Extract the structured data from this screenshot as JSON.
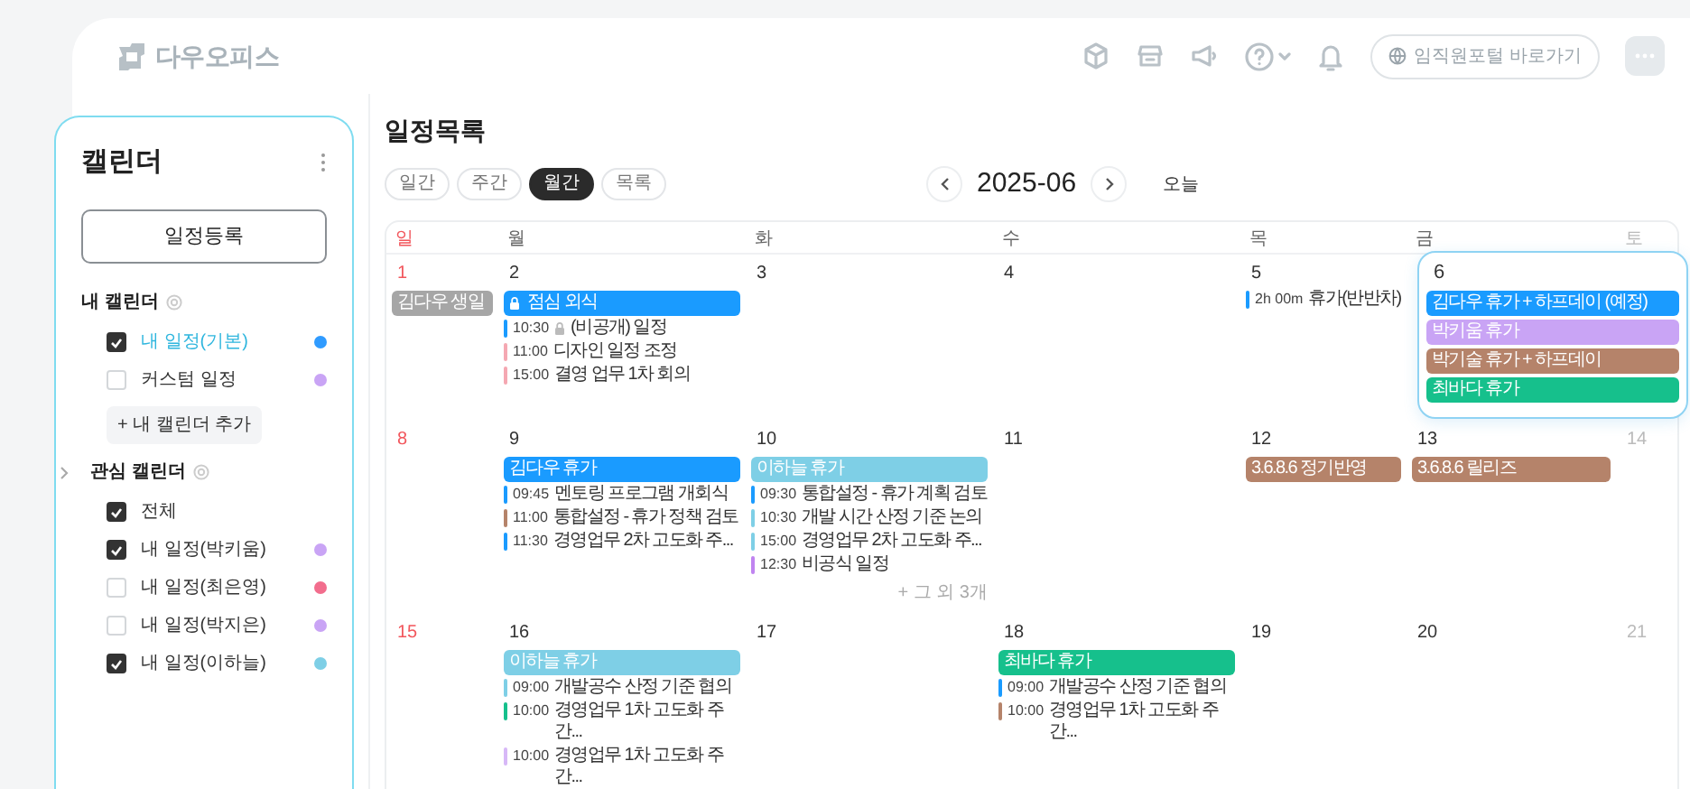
{
  "header": {
    "logo_text": "다우오피스",
    "portal_button": "임직원포털 바로가기"
  },
  "sidebar": {
    "title": "캘린더",
    "create_button": "일정등록",
    "sections": [
      {
        "title": "내 캘린더",
        "has_toggle": false,
        "add_button": "+ 내 캘린더 추가",
        "items": [
          {
            "label": "내 일정(기본)",
            "checked": true,
            "selected": true,
            "color": "#2f9bff"
          },
          {
            "label": "커스텀 일정",
            "checked": false,
            "selected": false,
            "color": "#c9a4f5"
          }
        ]
      },
      {
        "title": "관심 캘린더",
        "has_toggle": true,
        "items": [
          {
            "label": "전체",
            "checked": true,
            "selected": false
          },
          {
            "label": "내 일정(박키움)",
            "checked": true,
            "selected": false,
            "color": "#c9a4f5"
          },
          {
            "label": "내 일정(최은영)",
            "checked": false,
            "selected": false,
            "color": "#f26d8d"
          },
          {
            "label": "내 일정(박지은)",
            "checked": false,
            "selected": false,
            "color": "#c9a4f5"
          },
          {
            "label": "내 일정(이하늘)",
            "checked": true,
            "selected": false,
            "color": "#7ecfe6"
          }
        ]
      }
    ]
  },
  "main": {
    "title": "일정목록",
    "views": [
      {
        "label": "일간",
        "selected": false
      },
      {
        "label": "주간",
        "selected": false
      },
      {
        "label": "월간",
        "selected": true
      },
      {
        "label": "목록",
        "selected": false
      }
    ],
    "month": "2025-06",
    "today_button": "오늘",
    "calendar": {
      "weekdays": [
        "일",
        "월",
        "화",
        "수",
        "목",
        "금",
        "토"
      ],
      "weeks": [
        {
          "days": [
            {
              "day": "1",
              "events": [
                {
                  "kind": "bar",
                  "color": "#a6a6a6",
                  "title": "김다우 생일",
                  "locked": false
                }
              ]
            },
            {
              "day": "2",
              "events": [
                {
                  "kind": "bar",
                  "color": "#1a9bff",
                  "title": "점심 외식",
                  "locked": true
                },
                {
                  "kind": "timed",
                  "color": "#1a9bff",
                  "time": "10:30",
                  "title": "(비공개) 일정",
                  "locked": true
                },
                {
                  "kind": "timed",
                  "color": "#f5a8b2",
                  "time": "11:00",
                  "title": "디자인 일정 조정",
                  "locked": false
                },
                {
                  "kind": "timed",
                  "color": "#f5a8b2",
                  "time": "15:00",
                  "title": "결영 업무 1차 회의",
                  "locked": false
                }
              ]
            },
            {
              "day": "3"
            },
            {
              "day": "4"
            },
            {
              "day": "5",
              "events": [
                {
                  "kind": "timed",
                  "color": "#1a9bff",
                  "time": "2h 00m",
                  "title": "휴가(반반차)",
                  "locked": false
                }
              ]
            },
            {
              "day": "6",
              "expanded": true,
              "events": [
                {
                  "kind": "bar",
                  "color": "#1a9bff",
                  "title": "김다우 휴가 + 하프데이 (예정)",
                  "locked": false
                },
                {
                  "kind": "bar",
                  "color": "#c9a4f5",
                  "title": "박키움 휴가",
                  "locked": false
                },
                {
                  "kind": "bar",
                  "color": "#b5836a",
                  "title": "박기술 휴가 + 하프데이",
                  "locked": false
                },
                {
                  "kind": "bar",
                  "color": "#16c08c",
                  "title": "최바다 휴가",
                  "locked": false
                }
              ]
            }
          ]
        },
        {
          "days": [
            {
              "day": "8"
            },
            {
              "day": "9",
              "events": [
                {
                  "kind": "bar",
                  "color": "#1a9bff",
                  "title": "김다우 휴가",
                  "locked": false
                },
                {
                  "kind": "timed",
                  "color": "#1a9bff",
                  "time": "09:45",
                  "title": "멘토링 프로그램 개회식",
                  "locked": false
                },
                {
                  "kind": "timed",
                  "color": "#b5836a",
                  "time": "11:00",
                  "title": "통합설정 - 휴가 정책 검토",
                  "locked": false
                },
                {
                  "kind": "timed",
                  "color": "#1a9bff",
                  "time": "11:30",
                  "title": "경영업무 2차 고도화 주...",
                  "locked": false
                }
              ]
            },
            {
              "day": "10",
              "more": "+ 그 외 3개",
              "events": [
                {
                  "kind": "bar",
                  "color": "#7ecfe6",
                  "title": "이하늘 휴가",
                  "locked": false
                },
                {
                  "kind": "timed",
                  "color": "#1a9bff",
                  "time": "09:30",
                  "title": "통합설정 - 휴가 계획 검토",
                  "locked": false
                },
                {
                  "kind": "timed",
                  "color": "#7ecfe6",
                  "time": "10:30",
                  "title": "개발 시간 산정 기준 논의",
                  "locked": false
                },
                {
                  "kind": "timed",
                  "color": "#7ecfe6",
                  "time": "15:00",
                  "title": "경영업무 2차 고도화 주...",
                  "locked": false
                },
                {
                  "kind": "timed",
                  "color": "#c084f0",
                  "time": "12:30",
                  "title": "비공식 일정",
                  "locked": false
                }
              ]
            },
            {
              "day": "11"
            },
            {
              "day": "12",
              "events": [
                {
                  "kind": "bar",
                  "color": "#b5836a",
                  "title": "3.6.8.6 정기반영",
                  "locked": false
                }
              ]
            },
            {
              "day": "13",
              "events": [
                {
                  "kind": "bar",
                  "color": "#b5836a",
                  "title": "3.6.8.6 릴리즈",
                  "locked": false
                }
              ]
            },
            {
              "day": "14"
            }
          ]
        },
        {
          "days": [
            {
              "day": "15"
            },
            {
              "day": "16",
              "events": [
                {
                  "kind": "bar",
                  "color": "#7ecfe6",
                  "title": "이하늘 휴가",
                  "locked": false
                },
                {
                  "kind": "timed",
                  "color": "#7ecfe6",
                  "time": "09:00",
                  "title": "개발공수 산정 기준 협의",
                  "locked": false
                },
                {
                  "kind": "timed",
                  "color": "#16c08c",
                  "time": "10:00",
                  "title": "경영업무 1차 고도화 주간...",
                  "locked": false
                },
                {
                  "kind": "timed",
                  "color": "#d7b8f7",
                  "time": "10:00",
                  "title": "경영업무 1차 고도화 주간...",
                  "locked": false
                }
              ]
            },
            {
              "day": "17"
            },
            {
              "day": "18",
              "events": [
                {
                  "kind": "bar",
                  "color": "#16c08c",
                  "title": "최바다 휴가",
                  "locked": false
                },
                {
                  "kind": "timed",
                  "color": "#1a9bff",
                  "time": "09:00",
                  "title": "개발공수 산정 기준 협의",
                  "locked": false
                },
                {
                  "kind": "timed",
                  "color": "#b5836a",
                  "time": "10:00",
                  "title": "경영업무 1차 고도화 주간...",
                  "locked": false
                }
              ]
            },
            {
              "day": "19"
            },
            {
              "day": "20"
            },
            {
              "day": "21"
            }
          ]
        }
      ]
    }
  }
}
